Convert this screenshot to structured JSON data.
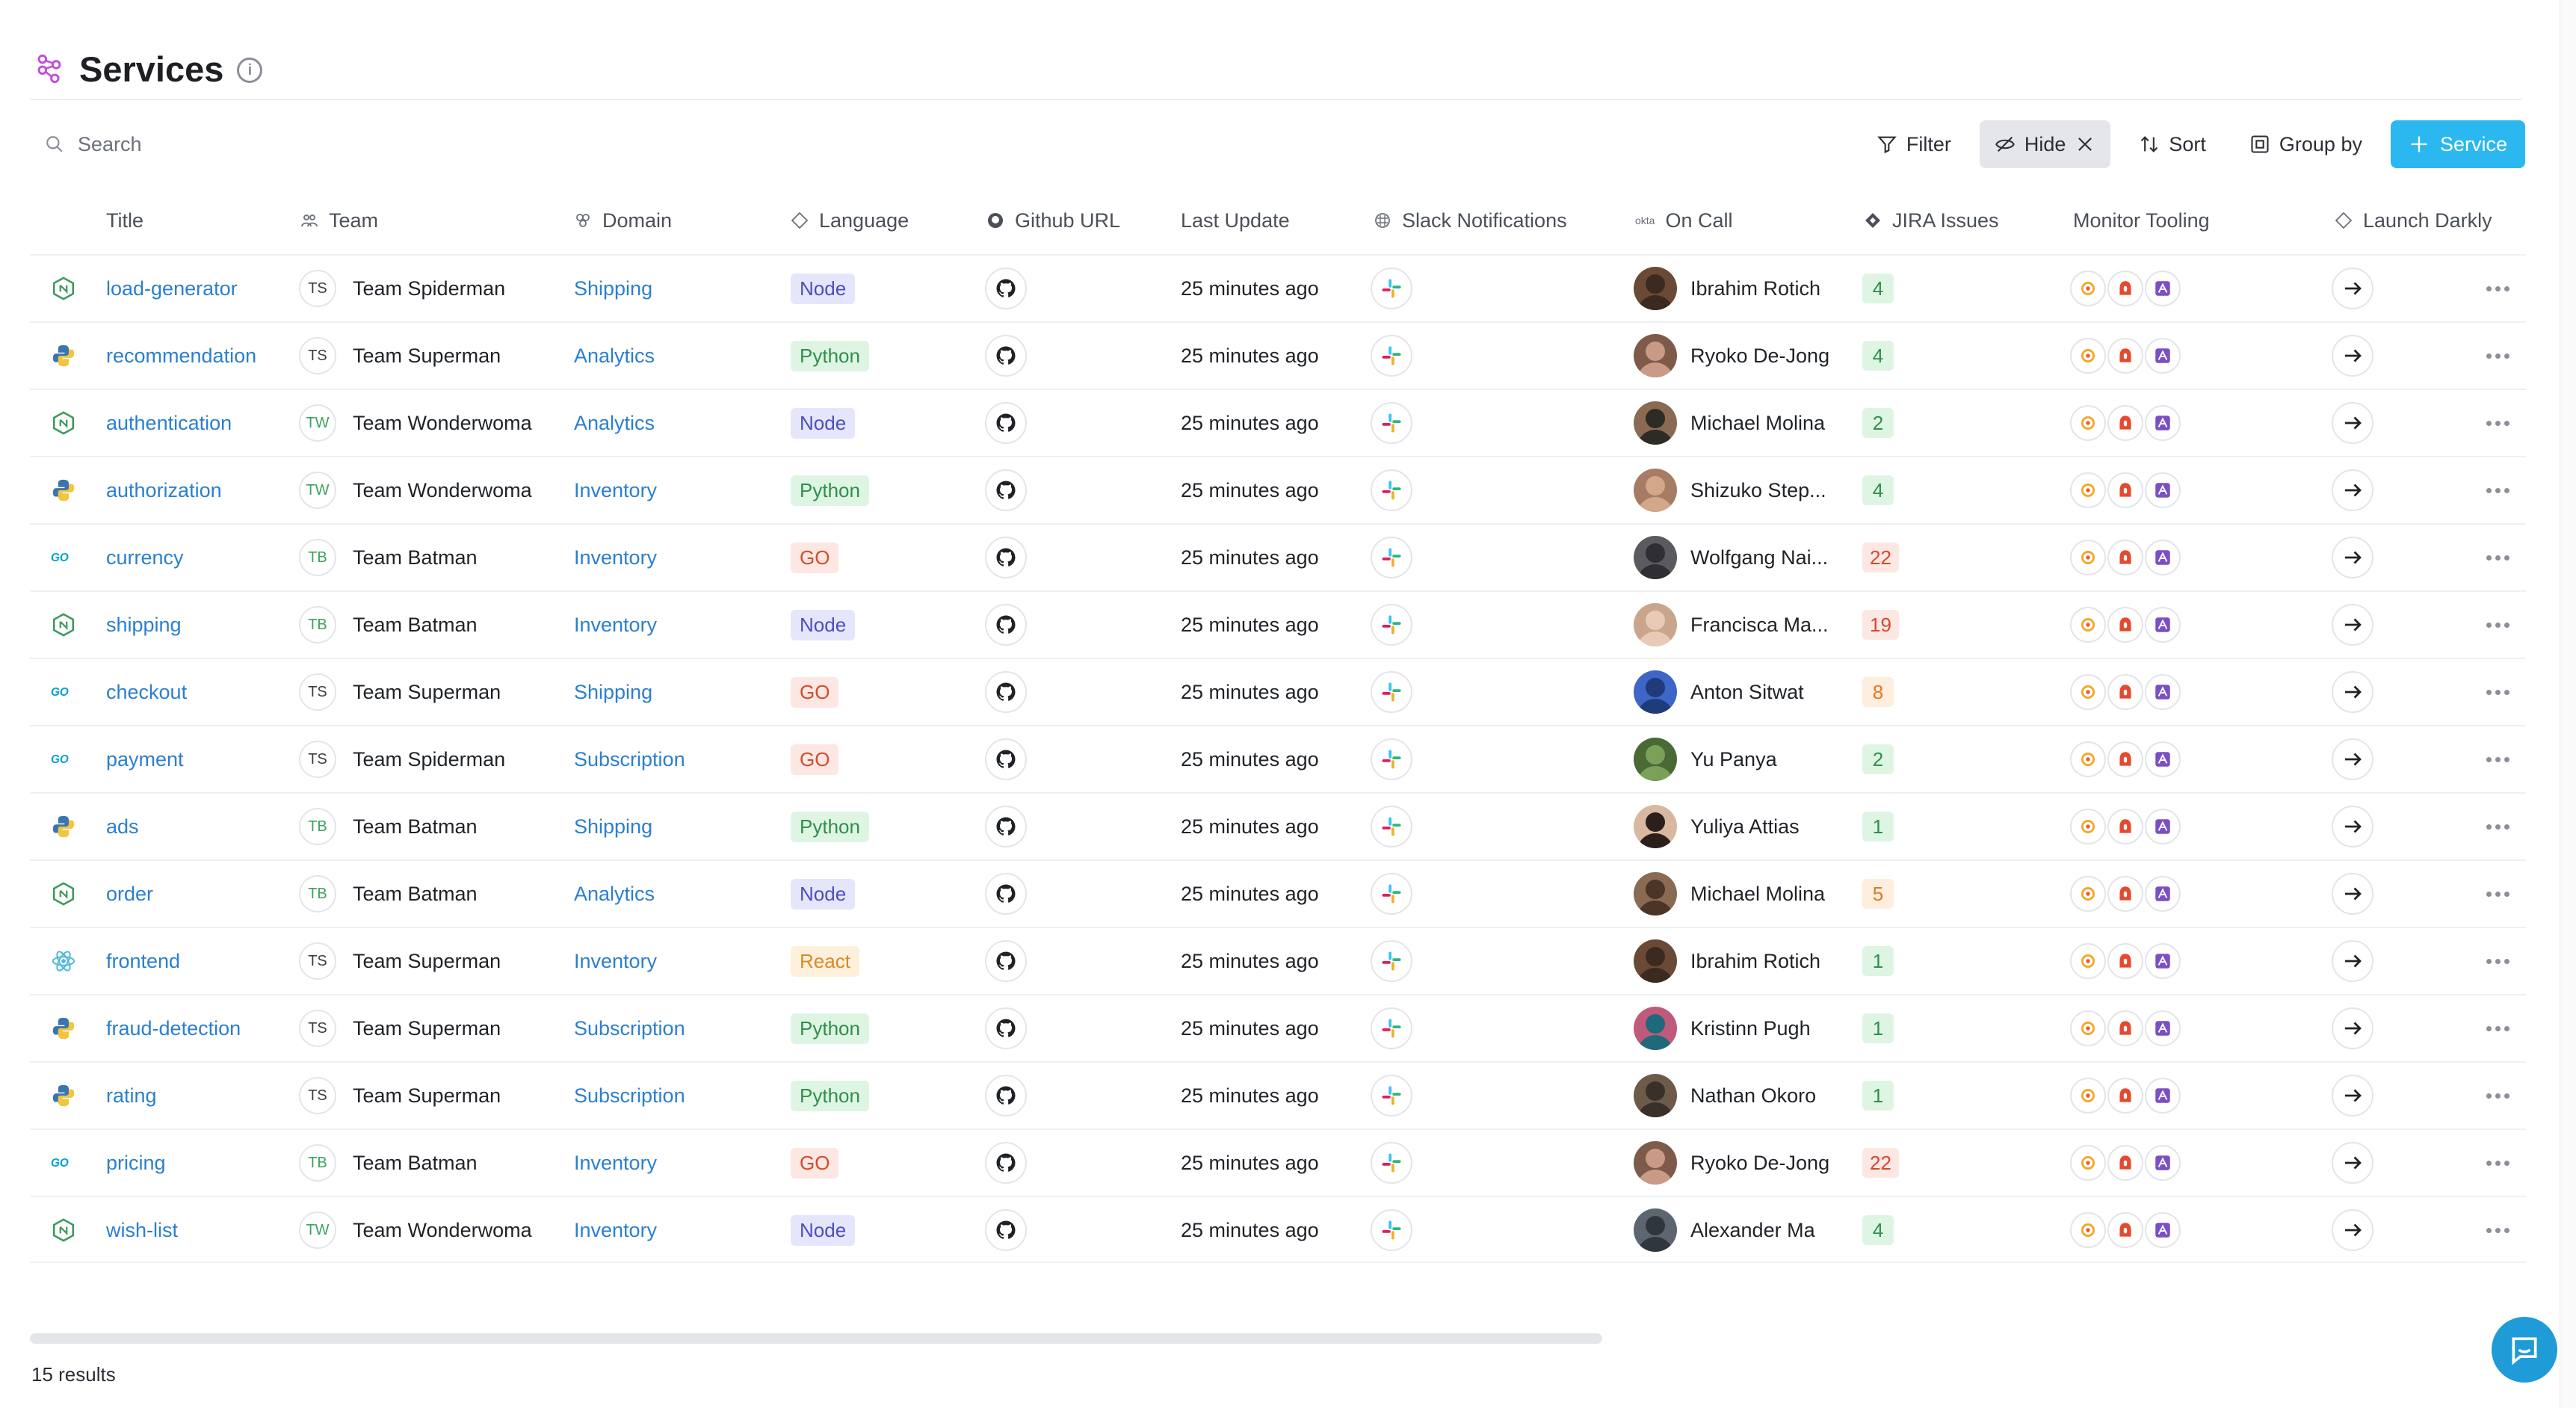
{
  "page": {
    "title": "Services",
    "title_icon": "services-icon",
    "info_icon": "info-icon"
  },
  "search": {
    "placeholder": "Search",
    "value": ""
  },
  "toolbar": {
    "filter_label": "Filter",
    "hide_label": "Hide",
    "sort_label": "Sort",
    "group_by_label": "Group by",
    "add_service_label": "Service"
  },
  "columns": {
    "title": "Title",
    "team": "Team",
    "domain": "Domain",
    "language": "Language",
    "github": "Github URL",
    "last_update": "Last Update",
    "slack": "Slack Notifications",
    "on_call": "On Call",
    "on_call_prefix": "okta",
    "jira": "JIRA Issues",
    "monitor": "Monitor Tooling",
    "launch_darkly": "Launch Darkly"
  },
  "rows": [
    {
      "title": "load-generator",
      "lang_icon": "node",
      "team_initials": "TS",
      "team": "Team Spiderman",
      "domain": "Shipping",
      "language": "Node",
      "last_update": "25 minutes ago",
      "on_call": "Ibrahim Rotich",
      "jira": "4",
      "jira_level": "green"
    },
    {
      "title": "recommendation",
      "lang_icon": "python",
      "team_initials": "TS",
      "team": "Team Superman",
      "domain": "Analytics",
      "language": "Python",
      "last_update": "25 minutes ago",
      "on_call": "Ryoko De-Jong",
      "jira": "4",
      "jira_level": "green"
    },
    {
      "title": "authentication",
      "lang_icon": "node",
      "team_initials": "TW",
      "team": "Team Wonderwoman",
      "domain": "Analytics",
      "language": "Node",
      "last_update": "25 minutes ago",
      "on_call": "Michael Molina",
      "jira": "2",
      "jira_level": "green"
    },
    {
      "title": "authorization",
      "lang_icon": "python",
      "team_initials": "TW",
      "team": "Team Wonderwoman",
      "domain": "Inventory",
      "language": "Python",
      "last_update": "25 minutes ago",
      "on_call": "Shizuko Step...",
      "jira": "4",
      "jira_level": "green"
    },
    {
      "title": "currency",
      "lang_icon": "go",
      "team_initials": "TB",
      "team": "Team Batman",
      "domain": "Inventory",
      "language": "GO",
      "last_update": "25 minutes ago",
      "on_call": "Wolfgang Nai...",
      "jira": "22",
      "jira_level": "red"
    },
    {
      "title": "shipping",
      "lang_icon": "node",
      "team_initials": "TB",
      "team": "Team Batman",
      "domain": "Inventory",
      "language": "Node",
      "last_update": "25 minutes ago",
      "on_call": "Francisca Ma...",
      "jira": "19",
      "jira_level": "red"
    },
    {
      "title": "checkout",
      "lang_icon": "go",
      "team_initials": "TS",
      "team": "Team Superman",
      "domain": "Shipping",
      "language": "GO",
      "last_update": "25 minutes ago",
      "on_call": "Anton Sitwat",
      "jira": "8",
      "jira_level": "orange"
    },
    {
      "title": "payment",
      "lang_icon": "go",
      "team_initials": "TS",
      "team": "Team Spiderman",
      "domain": "Subscription",
      "language": "GO",
      "last_update": "25 minutes ago",
      "on_call": "Yu Panya",
      "jira": "2",
      "jira_level": "green"
    },
    {
      "title": "ads",
      "lang_icon": "python",
      "team_initials": "TB",
      "team": "Team Batman",
      "domain": "Shipping",
      "language": "Python",
      "last_update": "25 minutes ago",
      "on_call": "Yuliya Attias",
      "jira": "1",
      "jira_level": "green"
    },
    {
      "title": "order",
      "lang_icon": "node",
      "team_initials": "TB",
      "team": "Team Batman",
      "domain": "Analytics",
      "language": "Node",
      "last_update": "25 minutes ago",
      "on_call": "Michael Molina",
      "jira": "5",
      "jira_level": "orange"
    },
    {
      "title": "frontend",
      "lang_icon": "react",
      "team_initials": "TS",
      "team": "Team Superman",
      "domain": "Inventory",
      "language": "React",
      "last_update": "25 minutes ago",
      "on_call": "Ibrahim Rotich",
      "jira": "1",
      "jira_level": "green"
    },
    {
      "title": "fraud-detection",
      "lang_icon": "python",
      "team_initials": "TS",
      "team": "Team Superman",
      "domain": "Subscription",
      "language": "Python",
      "last_update": "25 minutes ago",
      "on_call": "Kristinn Pugh",
      "jira": "1",
      "jira_level": "green"
    },
    {
      "title": "rating",
      "lang_icon": "python",
      "team_initials": "TS",
      "team": "Team Superman",
      "domain": "Subscription",
      "language": "Python",
      "last_update": "25 minutes ago",
      "on_call": "Nathan Okoro",
      "jira": "1",
      "jira_level": "green"
    },
    {
      "title": "pricing",
      "lang_icon": "go",
      "team_initials": "TB",
      "team": "Team Batman",
      "domain": "Inventory",
      "language": "GO",
      "last_update": "25 minutes ago",
      "on_call": "Ryoko De-Jong",
      "jira": "22",
      "jira_level": "red"
    },
    {
      "title": "wish-list",
      "lang_icon": "node",
      "team_initials": "TW",
      "team": "Team Wonderwoman",
      "domain": "Inventory",
      "language": "Node",
      "last_update": "25 minutes ago",
      "on_call": "Alexander Ma",
      "jira": "4",
      "jira_level": "green"
    }
  ],
  "footer": {
    "results": "15 results"
  },
  "colors": {
    "accent": "#2bb8f0",
    "link": "#2b7fd0",
    "chat": "#1f9bd8"
  }
}
